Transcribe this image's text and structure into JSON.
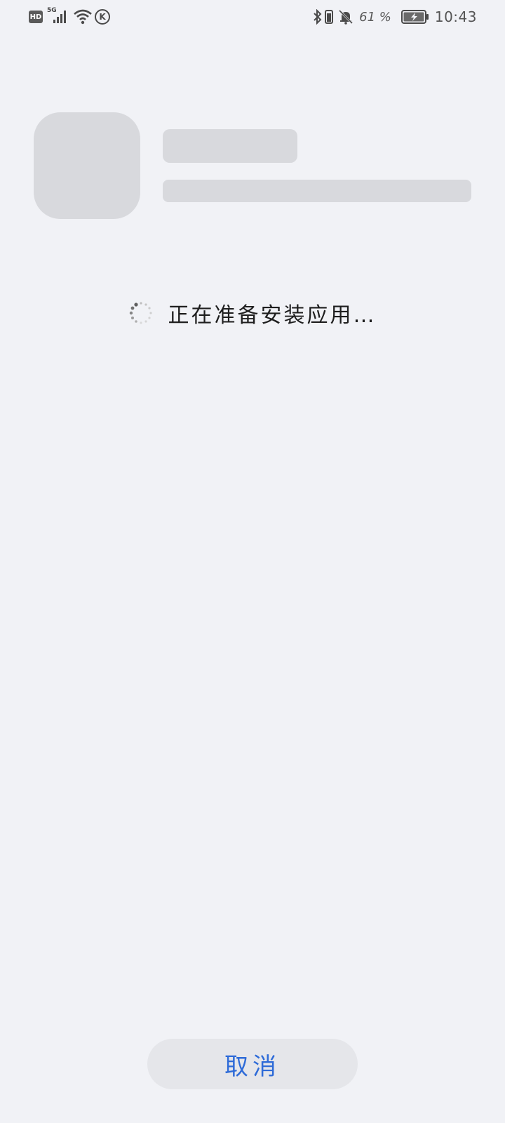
{
  "status_bar": {
    "hd": "HD",
    "network": "5G",
    "k_badge": "K",
    "battery_percent": "61 %",
    "time": "10:43",
    "icons": [
      "hd-icon",
      "signal-icon",
      "wifi-icon",
      "k-icon",
      "bluetooth-icon",
      "vibrate-icon",
      "bell-off-icon",
      "battery-charging-icon"
    ]
  },
  "main": {
    "status_text": "正在准备安装应用…",
    "cancel_label": "取消"
  },
  "colors": {
    "background": "#F1F2F6",
    "placeholder": "#D8D9DD",
    "button_bg": "#E5E6EA",
    "accent": "#2E6BD8"
  }
}
